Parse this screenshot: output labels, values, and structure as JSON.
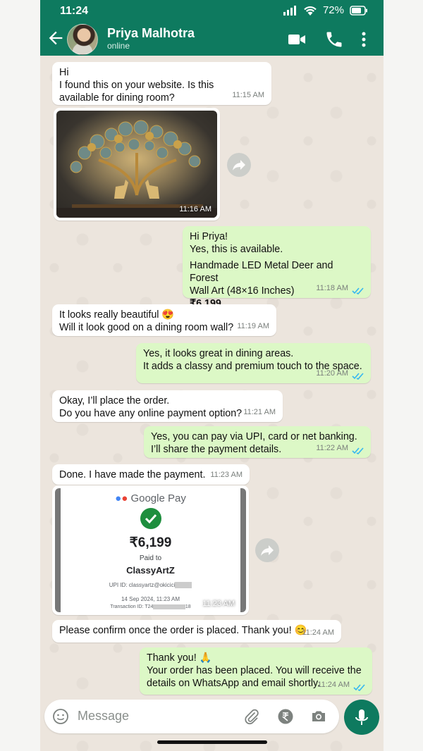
{
  "status_bar": {
    "time": "11:24",
    "battery": "72%",
    "icons": [
      "signal-icon",
      "wifi-icon",
      "battery-icon"
    ]
  },
  "header": {
    "contact_name": "Priya Malhotra",
    "contact_status": "online",
    "icons": [
      "back-arrow-icon",
      "avatar",
      "video-call-icon",
      "phone-icon",
      "more-vert-icon"
    ]
  },
  "messages": [
    {
      "dir": "in",
      "text": "Hi\nI found this on your website. Is this\navailable for dining room?",
      "time": "11:15 AM"
    },
    {
      "dir": "in",
      "type": "image",
      "time": "11:16 AM"
    },
    {
      "dir": "out",
      "text": "Hi Priya!\nYes, this is available.",
      "product": "Handmade LED Metal Deer and Forest\nWall Art (48×16 Inches)",
      "price": "₹6,199",
      "time": "11:18 AM"
    },
    {
      "dir": "in",
      "text": "It looks really beautiful 😍\nWill it look good on a dining room wall?",
      "time": "11:19 AM"
    },
    {
      "dir": "out",
      "text": "Yes, it looks great in dining areas.\nIt adds a classy and premium touch to the space.",
      "time": "11:20 AM"
    },
    {
      "dir": "in",
      "text": "Okay, I’ll place the order.\nDo you have any online payment option?",
      "time": "11:21 AM"
    },
    {
      "dir": "out",
      "text": "Yes, you can pay via UPI, card or net banking.\nI’ll share the payment details.",
      "time": "11:22 AM"
    },
    {
      "dir": "in",
      "text": "Done. I have made the payment.",
      "time": "11:23 AM"
    },
    {
      "dir": "in",
      "type": "payment-screenshot",
      "time": "11:23 AM"
    },
    {
      "dir": "in",
      "text": "Please confirm once the order is placed. Thank you! 😊",
      "time": "11:24 AM"
    },
    {
      "dir": "out",
      "text": "Thank you! 🙏\nYour order has been placed. You will receive the\ndetails on WhatsApp and email shortly.",
      "time": "11:24 AM"
    }
  ],
  "payment": {
    "app": "Google Pay",
    "amount": "₹6,199",
    "paid_to_label": "Paid to",
    "payee": "ClassyArtZ",
    "upi": "UPI ID: classyartz@okicici",
    "date": "14 Sep 2024, 11:23 AM",
    "transaction": "Transaction ID: T24",
    "transaction_tail": "18"
  },
  "input": {
    "placeholder": "Message"
  },
  "colors": {
    "header": "#0e7a5f",
    "out_bubble": "#dcf8c6",
    "in_bubble": "#ffffff",
    "tick_blue": "#34b7f1"
  }
}
